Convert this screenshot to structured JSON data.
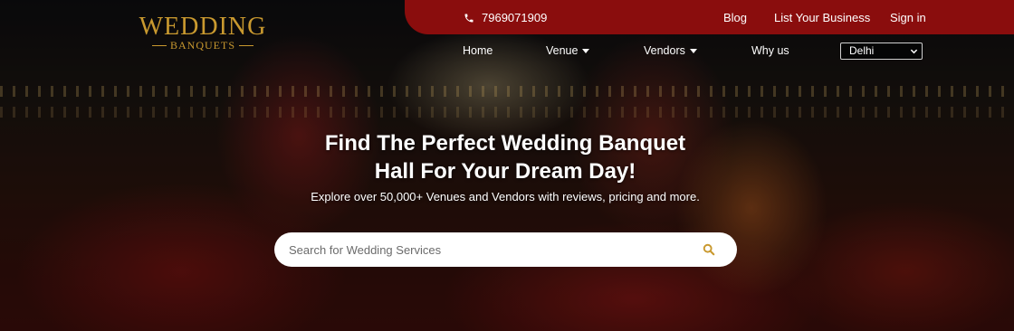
{
  "brand": {
    "name": "WEDDING",
    "tagline": "BANQUETS",
    "color": "#c9992f"
  },
  "topbar": {
    "phone": "7969071909",
    "links": [
      "Blog",
      "List Your Business",
      "Sign in"
    ],
    "background": "#8a0d0d"
  },
  "nav": {
    "items": [
      {
        "label": "Home"
      },
      {
        "label": "Venue"
      },
      {
        "label": "Vendors"
      },
      {
        "label": "Why us"
      }
    ],
    "city_selected": "Delhi"
  },
  "hero": {
    "title_line1": "Find The Perfect Wedding Banquet",
    "title_line2": "Hall For Your Dream Day!",
    "subtitle": "Explore over 50,000+ Venues and Vendors with reviews, pricing and more."
  },
  "search": {
    "placeholder": "Search for Wedding Services",
    "icon": "search-icon",
    "icon_color": "#c9992f"
  }
}
